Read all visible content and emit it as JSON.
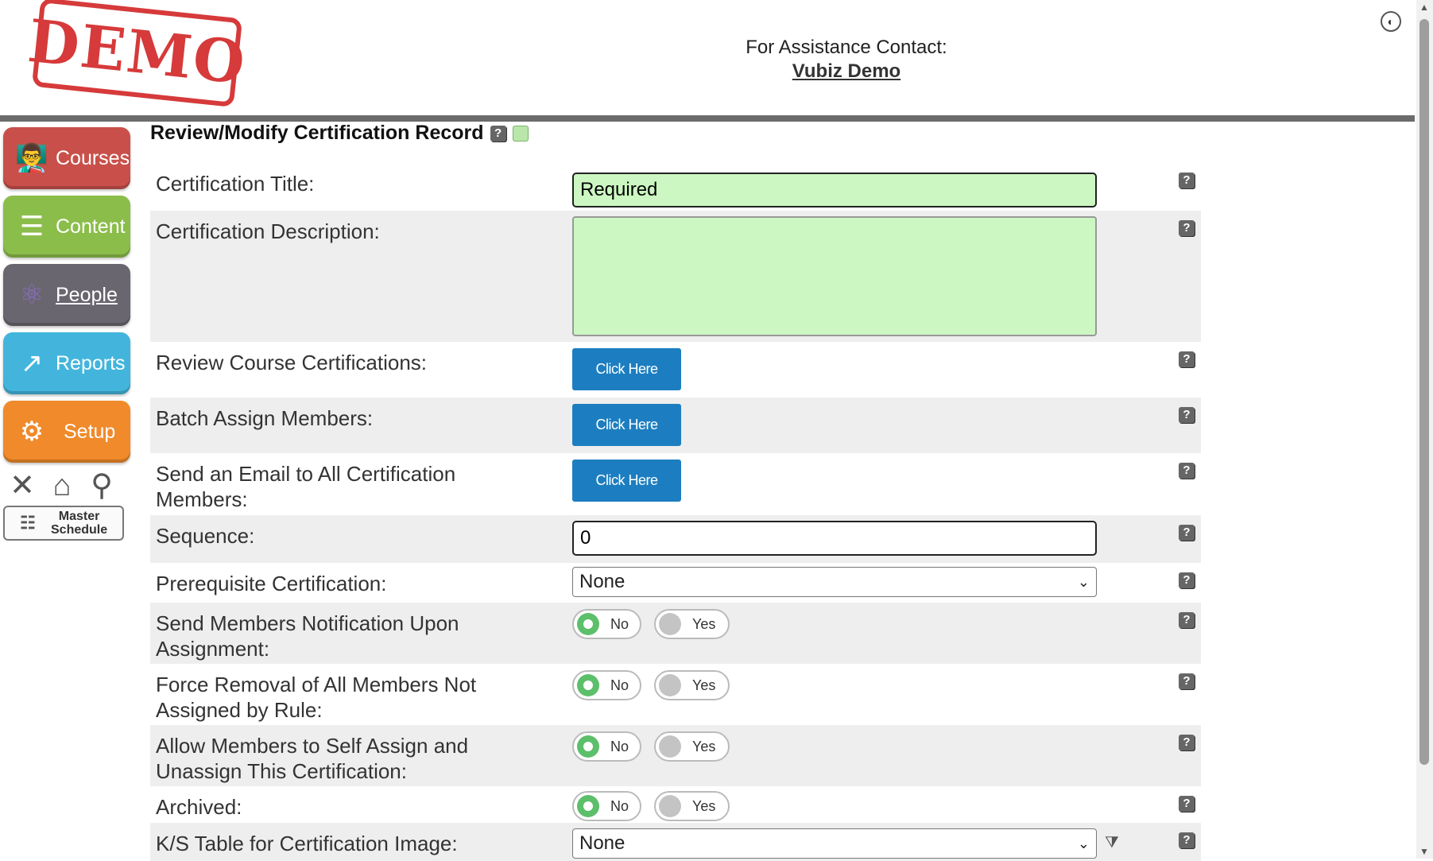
{
  "header": {
    "stamp_text": "DEMO",
    "assist_label": "For Assistance Contact:",
    "assist_link": "Vubiz Demo"
  },
  "sidebar": {
    "items": [
      {
        "label": "Courses",
        "icon": "teacher-icon",
        "color": "#c9504a"
      },
      {
        "label": "Content",
        "icon": "layers-icon",
        "color": "#8bbd4a"
      },
      {
        "label": "People",
        "icon": "people-network-icon",
        "color": "#6a6670"
      },
      {
        "label": "Reports",
        "icon": "chart-people-icon",
        "color": "#43b5dc"
      },
      {
        "label": "Setup",
        "icon": "gears-icon",
        "color": "#f08a2a"
      }
    ],
    "tools": [
      "close-icon",
      "home-icon",
      "search-icon"
    ],
    "master_schedule_line1": "Master",
    "master_schedule_line2": "Schedule"
  },
  "page": {
    "title": "Review/Modify Certification Record",
    "help_glyph": "?"
  },
  "form": {
    "cert_title_label": "Certification Title:",
    "cert_title_value": "Required",
    "cert_desc_label": "Certification Description:",
    "cert_desc_value": "",
    "review_label": "Review Course Certifications:",
    "batch_label": "Batch Assign Members:",
    "email_label": "Send an Email to All Certification Members:",
    "click_here": "Click Here",
    "sequence_label": "Sequence:",
    "sequence_value": "0",
    "prereq_label": "Prerequisite Certification:",
    "prereq_value": "None",
    "notify_label": "Send Members Notification Upon Assignment:",
    "force_label": "Force Removal of All Members Not Assigned by Rule:",
    "self_assign_label": "Allow Members to Self Assign and Unassign This Certification:",
    "archived_label": "Archived:",
    "ks_label": "K/S Table for Certification Image:",
    "ks_value": "None",
    "no": "No",
    "yes": "Yes",
    "selected_toggle": "No"
  },
  "colors": {
    "required_field_bg": "#ccf7c2",
    "button_blue": "#1c7ec0",
    "toggle_on": "#5cbf6a"
  }
}
